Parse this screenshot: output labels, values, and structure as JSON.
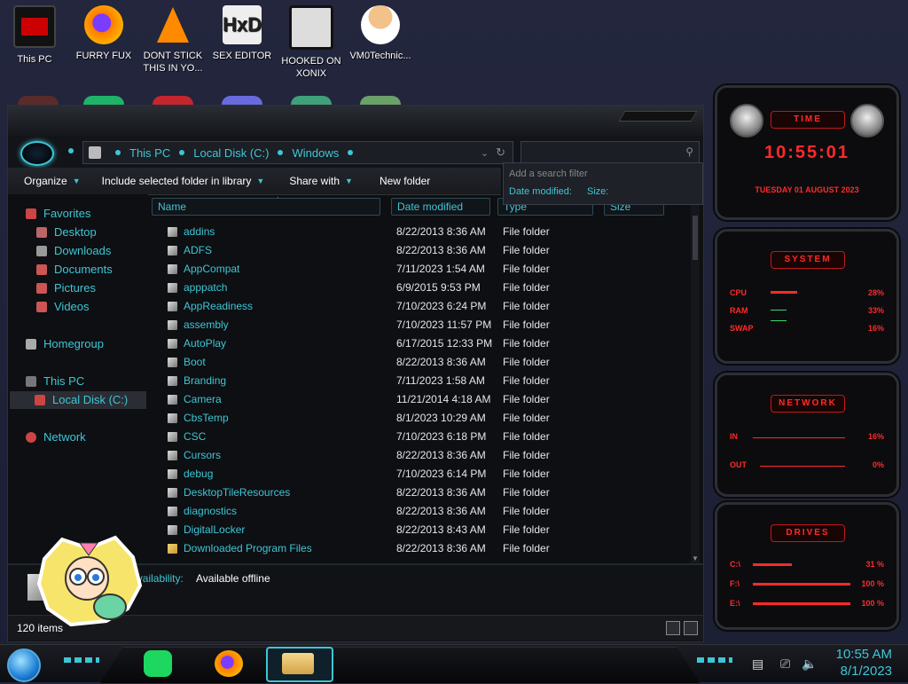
{
  "desktop_icons": [
    {
      "label": "This PC",
      "icon": "monitor-icon"
    },
    {
      "label": "FURRY FUX",
      "icon": "firefox-icon"
    },
    {
      "label": "DONT STICK THIS IN YO...",
      "icon": "vlc-cone-icon"
    },
    {
      "label": "SEX EDITOR",
      "icon": "hxd-editor-icon"
    },
    {
      "label": "HOOKED ON XONIX",
      "icon": "game-icon"
    },
    {
      "label": "VM0Technic...",
      "icon": "doctor-icon"
    }
  ],
  "explorer": {
    "breadcrumb": [
      "This PC",
      "Local Disk (C:)",
      "Windows"
    ],
    "search_placeholder": "",
    "search_popup": {
      "hint": "Add a search filter",
      "filters": [
        "Date modified:",
        "Size:"
      ]
    },
    "toolbar": {
      "organize": "Organize",
      "include": "Include selected folder in library",
      "share": "Share with",
      "new_folder": "New folder"
    },
    "nav": {
      "favorites": "Favorites",
      "desktop": "Desktop",
      "downloads": "Downloads",
      "documents": "Documents",
      "pictures": "Pictures",
      "videos": "Videos",
      "homegroup": "Homegroup",
      "this_pc": "This PC",
      "local_disk": "Local Disk (C:)",
      "network": "Network"
    },
    "columns": {
      "name": "Name",
      "date": "Date modified",
      "type": "Type",
      "size": "Size"
    },
    "files": [
      {
        "name": "addins",
        "date": "8/22/2013 8:36 AM",
        "type": "File folder"
      },
      {
        "name": "ADFS",
        "date": "8/22/2013 8:36 AM",
        "type": "File folder"
      },
      {
        "name": "AppCompat",
        "date": "7/11/2023 1:54 AM",
        "type": "File folder"
      },
      {
        "name": "apppatch",
        "date": "6/9/2015 9:53 PM",
        "type": "File folder"
      },
      {
        "name": "AppReadiness",
        "date": "7/10/2023 6:24 PM",
        "type": "File folder"
      },
      {
        "name": "assembly",
        "date": "7/10/2023 11:57 PM",
        "type": "File folder"
      },
      {
        "name": "AutoPlay",
        "date": "6/17/2015 12:33 PM",
        "type": "File folder"
      },
      {
        "name": "Boot",
        "date": "8/22/2013 8:36 AM",
        "type": "File folder"
      },
      {
        "name": "Branding",
        "date": "7/11/2023 1:58 AM",
        "type": "File folder"
      },
      {
        "name": "Camera",
        "date": "11/21/2014 4:18 AM",
        "type": "File folder"
      },
      {
        "name": "CbsTemp",
        "date": "8/1/2023 10:29 AM",
        "type": "File folder"
      },
      {
        "name": "CSC",
        "date": "7/10/2023 6:18 PM",
        "type": "File folder"
      },
      {
        "name": "Cursors",
        "date": "8/22/2013 8:36 AM",
        "type": "File folder"
      },
      {
        "name": "debug",
        "date": "7/10/2023 6:14 PM",
        "type": "File folder"
      },
      {
        "name": "DesktopTileResources",
        "date": "8/22/2013 8:36 AM",
        "type": "File folder"
      },
      {
        "name": "diagnostics",
        "date": "8/22/2013 8:36 AM",
        "type": "File folder"
      },
      {
        "name": "DigitalLocker",
        "date": "8/22/2013 8:43 AM",
        "type": "File folder"
      },
      {
        "name": "Downloaded Program Files",
        "date": "8/22/2013 8:36 AM",
        "type": "File folder"
      }
    ],
    "details": {
      "label": "Availability:",
      "value": "Available offline"
    },
    "status": {
      "count": "120 items"
    }
  },
  "widgets": {
    "time": {
      "title": "TIME",
      "time": "10:55:01",
      "date": "TUESDAY 01 AUGUST 2023"
    },
    "system": {
      "title": "SYSTEM",
      "rows": [
        {
          "label": "CPU",
          "value": "28%"
        },
        {
          "label": "RAM",
          "value": "33%"
        },
        {
          "label": "SWAP",
          "value": "16%"
        }
      ]
    },
    "network": {
      "title": "NETWORK",
      "rows": [
        {
          "label": "IN",
          "value": "16%"
        },
        {
          "label": "OUT",
          "value": "0%"
        }
      ]
    },
    "drives": {
      "title": "DRIVES",
      "rows": [
        {
          "label": "C:\\",
          "value": "31 %"
        },
        {
          "label": "F:\\",
          "value": "100 %"
        },
        {
          "label": "E:\\",
          "value": "100 %"
        }
      ]
    }
  },
  "taskbar": {
    "apps": [
      "spotify-icon",
      "firefox-icon",
      "file-explorer-icon"
    ],
    "clock_time": "10:55 AM",
    "clock_date": "8/1/2023"
  },
  "colors": {
    "accent": "#3ec6d6",
    "widget_red": "#ff2a2a"
  }
}
